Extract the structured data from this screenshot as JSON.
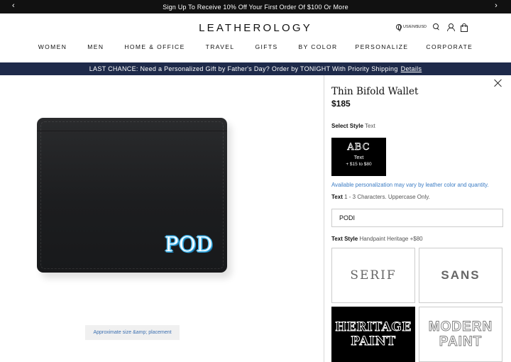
{
  "promo": {
    "text": "Sign Up To Receive 10% Off Your First Order Of $100 Or More",
    "prev": "‹",
    "next": "›"
  },
  "header": {
    "logo": "LEATHEROLOGY",
    "locale": "US/EN/$USD",
    "nav": [
      "WOMEN",
      "MEN",
      "HOME & OFFICE",
      "TRAVEL",
      "GIFTS",
      "BY COLOR",
      "PERSONALIZE",
      "CORPORATE"
    ],
    "icons": [
      "globe-icon",
      "search-icon",
      "account-icon",
      "bag-icon"
    ]
  },
  "announcement": {
    "text": "LAST CHANCE: Need a Personalized Gift by Father's Day? Order by TONIGHT With Priority Shipping",
    "link": "Details"
  },
  "product_image": {
    "monogram": "POD",
    "monogram_color": "#3fb3ea",
    "approx_label": "Approximate size &amp; placement"
  },
  "panel": {
    "title": "Thin Bifold Wallet",
    "price": "$185",
    "select_style_label": "Select Style",
    "select_style_value": "Text",
    "style_option": {
      "preview": "ABC",
      "name": "Text",
      "price": "+ $15 to $80"
    },
    "note": "Available personalization may vary by leather color and quantity.",
    "text_label": "Text",
    "text_hint": "1 - 3 Characters. Uppercase Only.",
    "text_value": "PODI",
    "text_style_label": "Text Style",
    "text_style_value": "Handpaint Heritage +$80",
    "tiles": {
      "serif": "SERIF",
      "sans": "SANS",
      "heritage_line1": "HERITAGE",
      "heritage_line2": "PAINT",
      "modern_line1": "MODERN",
      "modern_line2": "PAINT"
    },
    "link_color": "#3b7cc4",
    "announce_color": "#1e2a4a"
  }
}
